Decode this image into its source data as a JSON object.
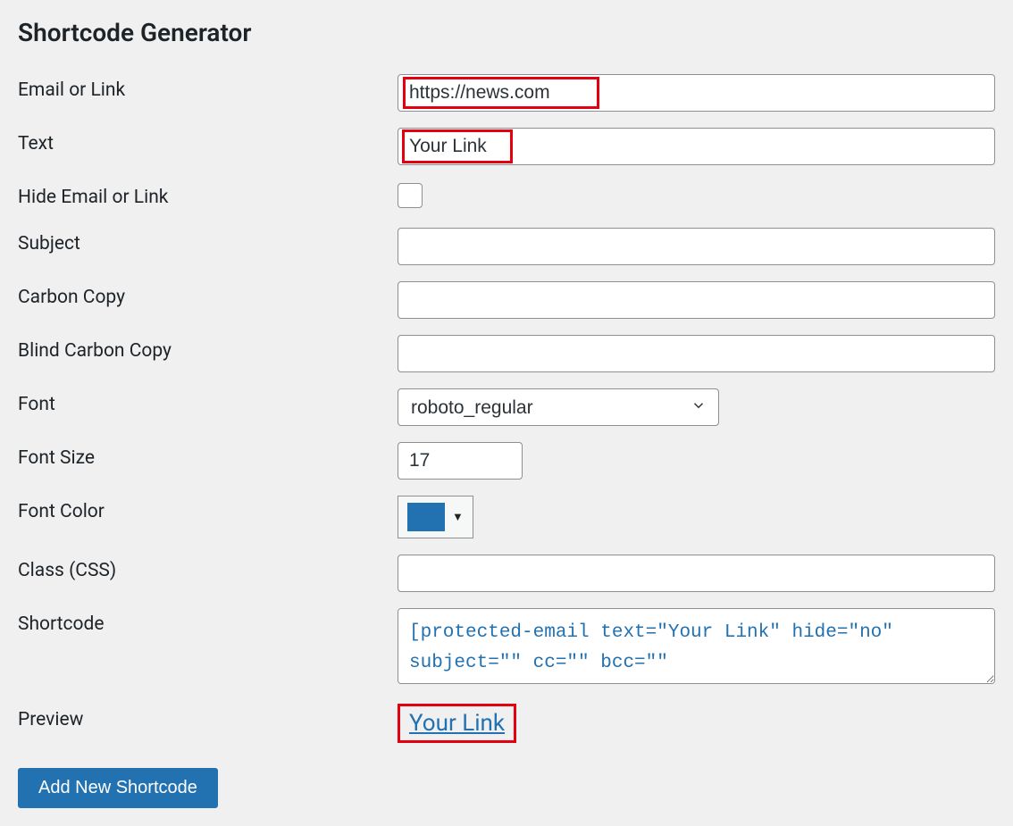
{
  "page": {
    "title": "Shortcode Generator"
  },
  "labels": {
    "email_or_link": "Email or Link",
    "text": "Text",
    "hide": "Hide Email or Link",
    "subject": "Subject",
    "cc": "Carbon Copy",
    "bcc": "Blind Carbon Copy",
    "font": "Font",
    "font_size": "Font Size",
    "font_color": "Font Color",
    "class": "Class (CSS)",
    "shortcode": "Shortcode",
    "preview": "Preview"
  },
  "values": {
    "email_or_link": "https://news.com",
    "text": "Your Link",
    "hide": false,
    "subject": "",
    "cc": "",
    "bcc": "",
    "font": "roboto_regular",
    "font_size": "17",
    "font_color": "#2271b1",
    "class": "",
    "shortcode": "[protected-email text=\"Your Link\" hide=\"no\" subject=\"\" cc=\"\" bcc=\"\""
  },
  "preview": {
    "link_text": "Your Link"
  },
  "buttons": {
    "add": "Add New Shortcode"
  }
}
